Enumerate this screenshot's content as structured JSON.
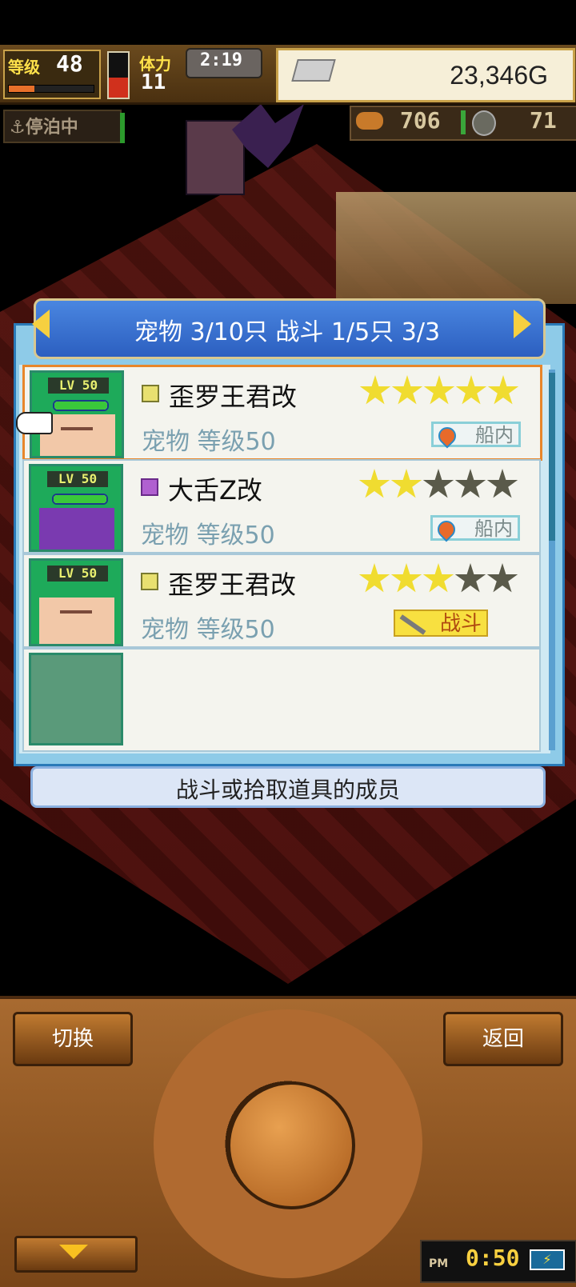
{
  "hud": {
    "level_label": "等级",
    "level_value": "48",
    "xp_fraction": 0.3,
    "stamina_label": "体力",
    "stamina_value": "11",
    "stamina_fraction": 0.45,
    "clock": "2:19",
    "gold": "23,346G",
    "anchor_status": "停泊中",
    "food": "706",
    "coins": "71"
  },
  "panel": {
    "title": "宠物 3/10只 战斗 1/5只 3/3",
    "hint": "战斗或拾取道具的成员",
    "pets": [
      {
        "lv": "LV 50",
        "name": "歪罗王君改",
        "sub": "宠物 等级50",
        "stars_on": 5,
        "stars_total": 5,
        "location": "船内",
        "rarity": "yellow",
        "selected": true
      },
      {
        "lv": "LV 50",
        "name": "大舌Z改",
        "sub": "宠物 等级50",
        "stars_on": 2,
        "stars_total": 5,
        "location": "船内",
        "rarity": "purple",
        "selected": false
      },
      {
        "lv": "LV 50",
        "name": "歪罗王君改",
        "sub": "宠物 等级50",
        "stars_on": 3,
        "stars_total": 5,
        "location": "战斗",
        "rarity": "yellow",
        "selected": false
      }
    ]
  },
  "controls": {
    "switch_label": "切换",
    "back_label": "返回"
  },
  "status": {
    "ampm": "PM",
    "time": "0:50",
    "battery_icon": "⚡"
  },
  "colors": {
    "accent_blue": "#2c5fc0",
    "selection_orange": "#e8862a",
    "star_on": "#f0dc30",
    "battle_tag": "#f8e040"
  }
}
